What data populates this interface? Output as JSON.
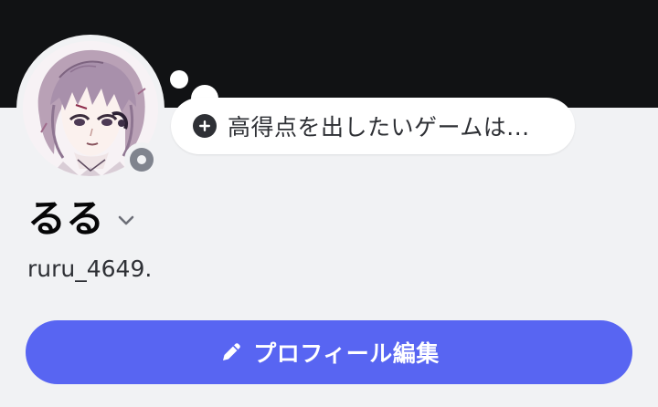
{
  "profile": {
    "display_name": "るる",
    "username": "ruru_4649.",
    "status": "offline",
    "custom_status_placeholder": "高得点を出したいゲームは..."
  },
  "actions": {
    "edit_profile_label": "プロフィール編集"
  },
  "icons": {
    "add_status": "plus-circle-icon",
    "dropdown": "chevron-down-icon",
    "edit": "pencil-icon",
    "status": "offline-status-icon"
  },
  "colors": {
    "banner": "#111214",
    "background": "#f1f2f4",
    "accent": "#5865f2",
    "status_offline": "#80848e"
  }
}
